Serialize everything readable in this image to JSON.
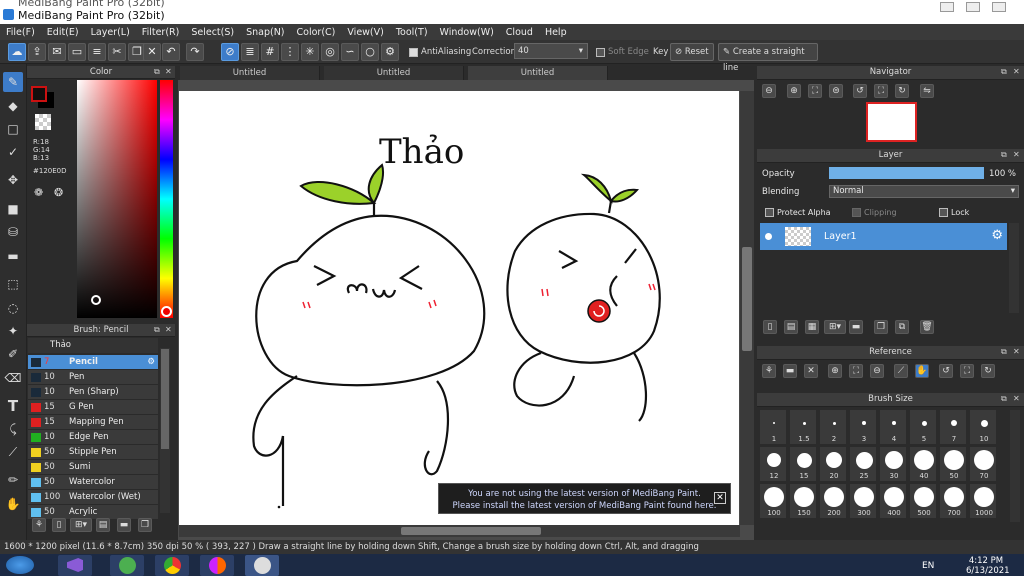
{
  "window": {
    "title": "MediBang Paint Pro (32bit)",
    "title_ghost": "MediBang Paint Pro (32bit)"
  },
  "menu": [
    "File(F)",
    "Edit(E)",
    "Layer(L)",
    "Filter(R)",
    "Select(S)",
    "Snap(N)",
    "Color(C)",
    "View(V)",
    "Tool(T)",
    "Window(W)",
    "Cloud",
    "Help"
  ],
  "toolbar": {
    "antialiasing_label": "AntiAliasing",
    "correction_label": "Correction",
    "correction_value": "40",
    "soft_edge_label": "Soft Edge",
    "key_label": "Key",
    "reset_label": "Reset",
    "straight_line_label": "Create a straight line"
  },
  "color_panel": {
    "title": "Color",
    "r": "R:18",
    "g": "G:14",
    "b": "B:13",
    "hex": "#120E0D",
    "primary_color": "#cc1111",
    "secondary_color": "#000000"
  },
  "brush_panel": {
    "title": "Brush: Pencil",
    "group": "Thảo",
    "items": [
      {
        "size": "7",
        "name": "Pencil",
        "color": "#1a2a3a",
        "selected": true
      },
      {
        "size": "10",
        "name": "Pen",
        "color": "#1a2a3a"
      },
      {
        "size": "10",
        "name": "Pen (Sharp)",
        "color": "#1a2a3a"
      },
      {
        "size": "15",
        "name": "G Pen",
        "color": "#e02020"
      },
      {
        "size": "15",
        "name": "Mapping Pen",
        "color": "#e02020"
      },
      {
        "size": "10",
        "name": "Edge Pen",
        "color": "#20b020"
      },
      {
        "size": "50",
        "name": "Stipple Pen",
        "color": "#f0d020"
      },
      {
        "size": "50",
        "name": "Sumi",
        "color": "#f0d020"
      },
      {
        "size": "50",
        "name": "Watercolor",
        "color": "#60c0f0"
      },
      {
        "size": "100",
        "name": "Watercolor (Wet)",
        "color": "#60c0f0"
      },
      {
        "size": "50",
        "name": "Acrylic",
        "color": "#60c0f0"
      }
    ]
  },
  "canvas": {
    "tabs": [
      "Untitled",
      "Untitled",
      "Untitled"
    ],
    "handwriting": "Thảo",
    "notice_line1": "You are not using the latest version of MediBang Paint.",
    "notice_line2": "Please install the latest version of MediBang Paint found here."
  },
  "navigator": {
    "title": "Navigator"
  },
  "layer_panel": {
    "title": "Layer",
    "opacity_label": "Opacity",
    "opacity_value": "100 %",
    "opacity_fraction": 1.0,
    "blending_label": "Blending",
    "blending_value": "Normal",
    "protect_alpha": "Protect Alpha",
    "clipping": "Clipping",
    "lock": "Lock",
    "layer_name": "Layer1"
  },
  "reference": {
    "title": "Reference"
  },
  "brush_size": {
    "title": "Brush Size",
    "sizes": [
      "1",
      "1.5",
      "2",
      "3",
      "4",
      "5",
      "7",
      "10",
      "12",
      "15",
      "20",
      "25",
      "30",
      "40",
      "50",
      "70",
      "100",
      "150",
      "200",
      "300",
      "400",
      "500",
      "700",
      "1000"
    ]
  },
  "status": {
    "text": "1600 * 1200 pixel   (11.6 * 8.7cm)   350 dpi   50 %   ( 393, 227 )   Draw a straight line by holding down Shift, Change a brush size by holding down Ctrl, Alt, and dragging"
  },
  "taskbar": {
    "lang": "EN",
    "time": "4:12 PM",
    "date": "6/13/2021"
  }
}
